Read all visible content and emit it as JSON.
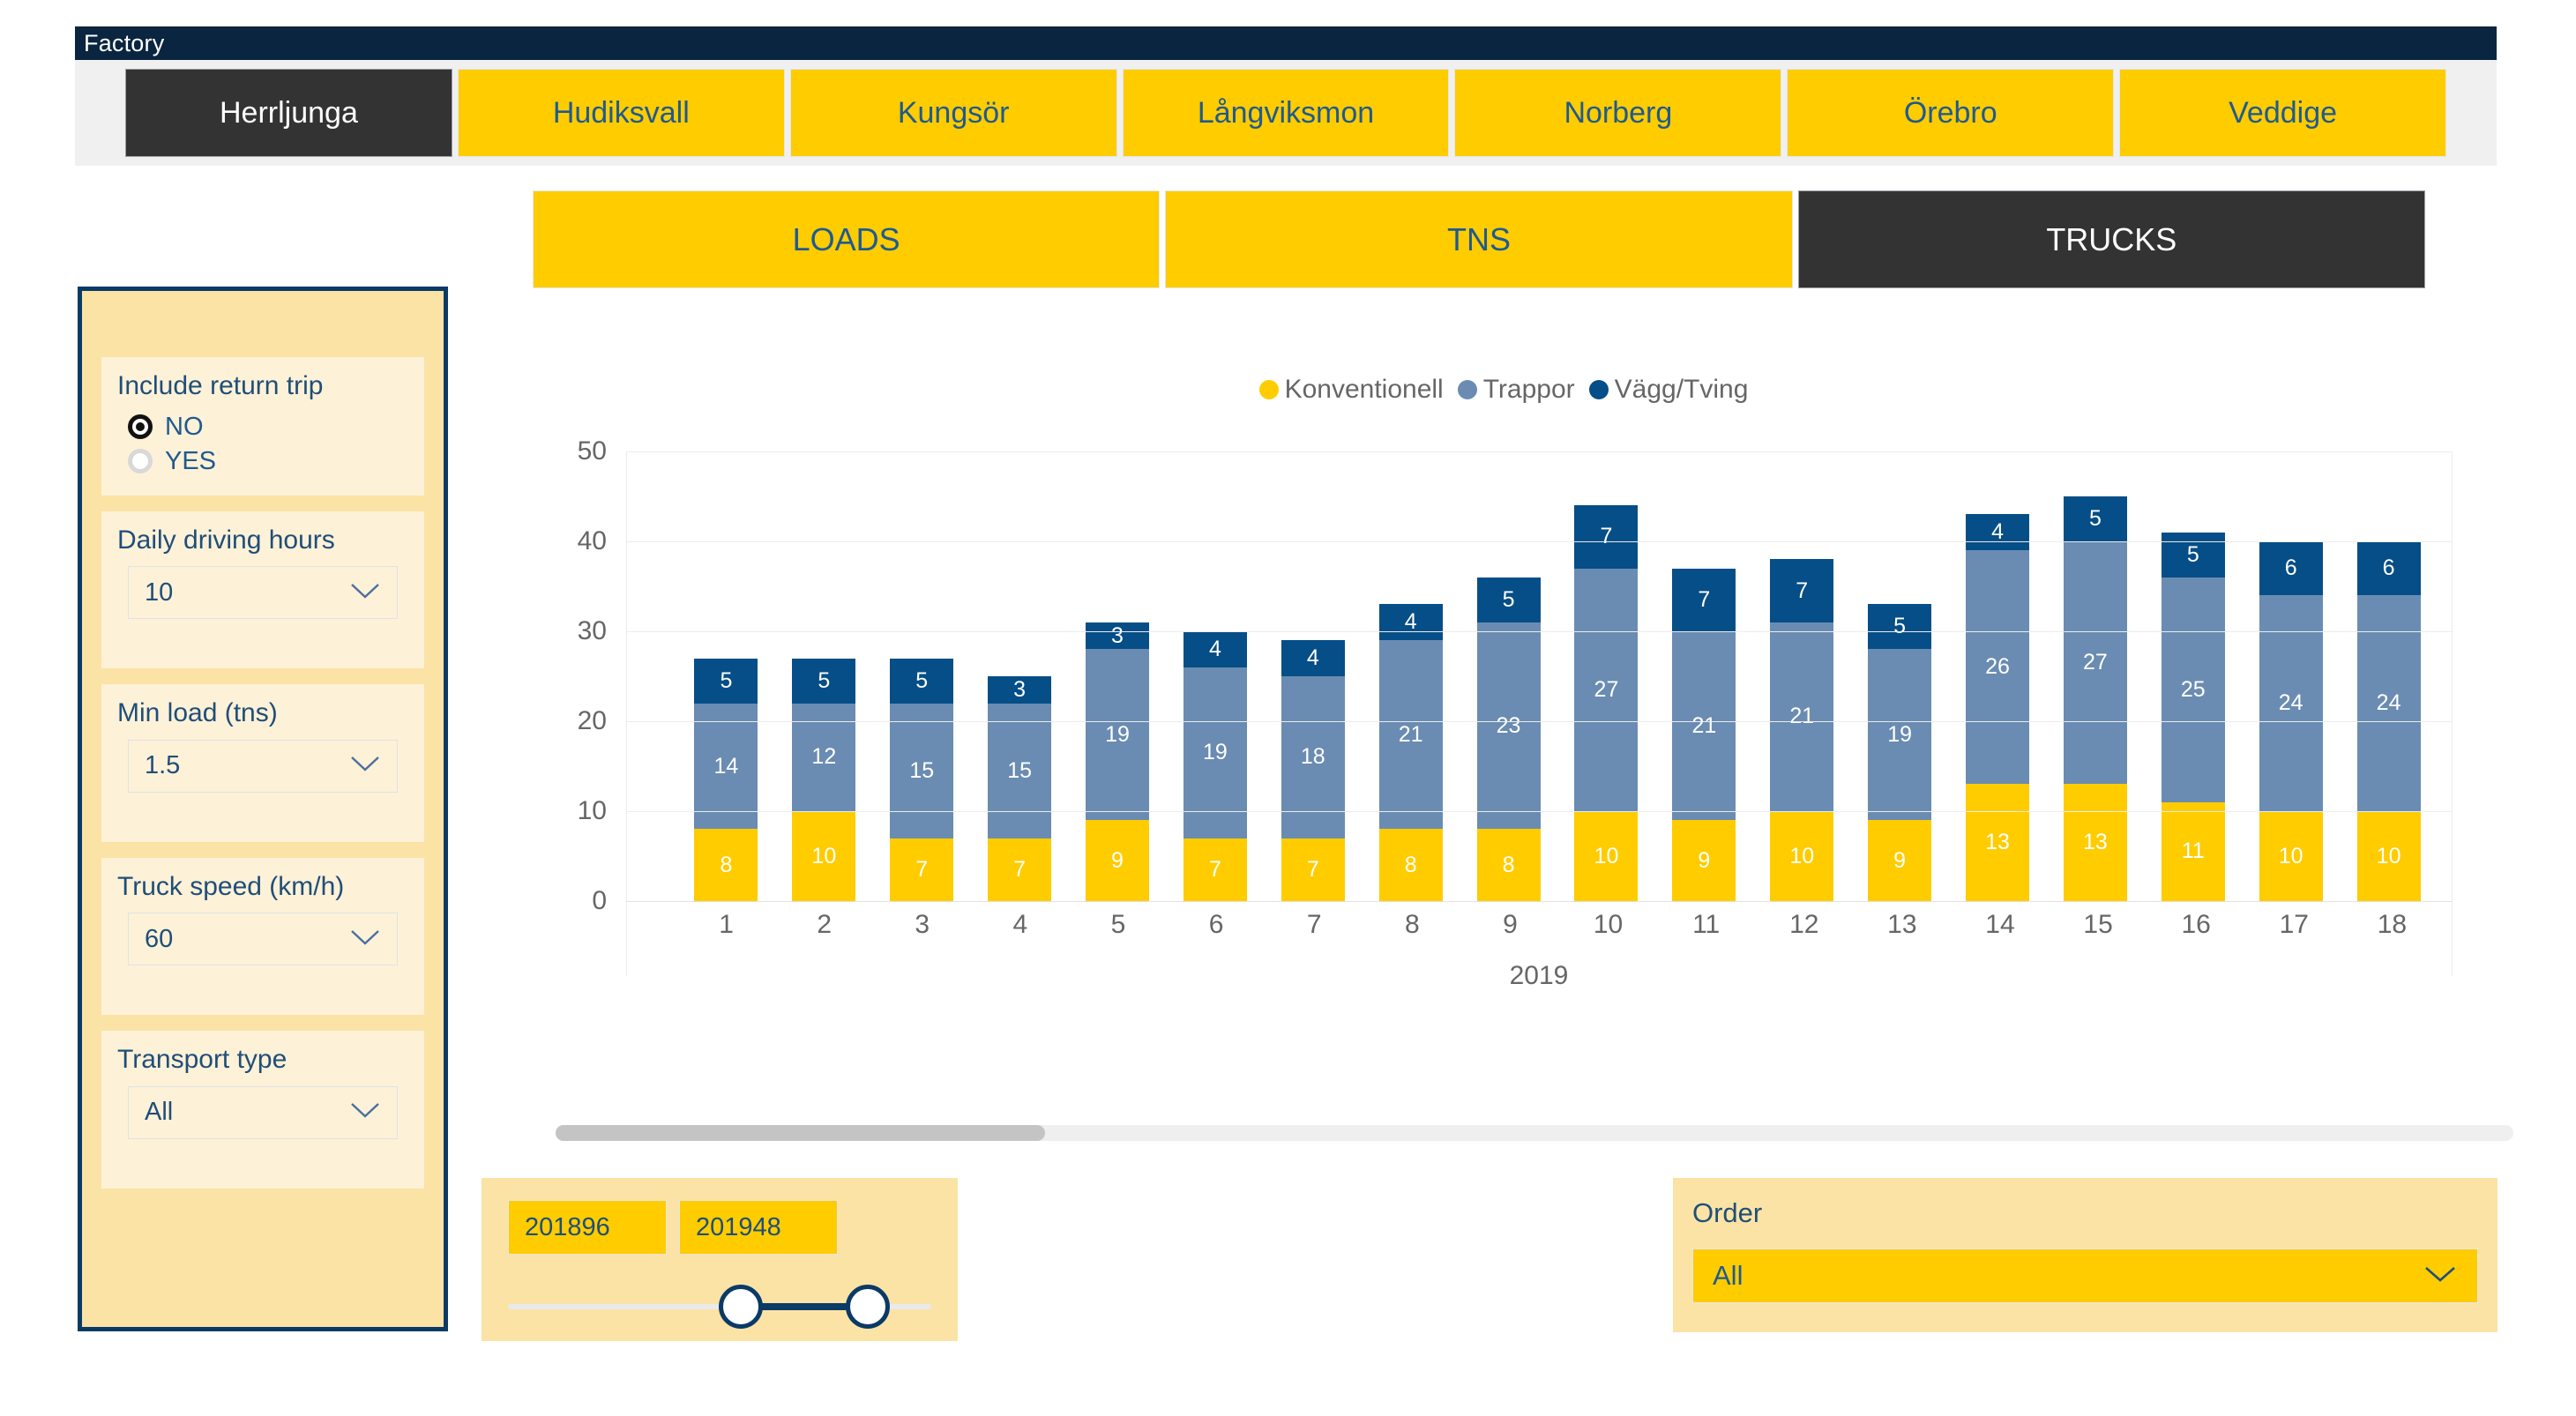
{
  "header": {
    "title": "Factory",
    "tabs": [
      {
        "label": "Herrljunga",
        "active": true
      },
      {
        "label": "Hudiksvall",
        "active": false
      },
      {
        "label": "Kungsör",
        "active": false
      },
      {
        "label": "Långviksmon",
        "active": false
      },
      {
        "label": "Norberg",
        "active": false
      },
      {
        "label": "Örebro",
        "active": false
      },
      {
        "label": "Veddige",
        "active": false
      }
    ]
  },
  "subtabs": [
    {
      "label": "LOADS",
      "active": false
    },
    {
      "label": "TNS",
      "active": false
    },
    {
      "label": "TRUCKS",
      "active": true
    }
  ],
  "sidebar": {
    "filters": [
      {
        "title": "Include return trip",
        "type": "radio",
        "options": [
          {
            "label": "NO",
            "checked": true
          },
          {
            "label": "YES",
            "checked": false
          }
        ]
      },
      {
        "title": "Daily driving hours",
        "type": "select",
        "value": "10"
      },
      {
        "title": "Min load (tns)",
        "type": "select",
        "value": "1.5"
      },
      {
        "title": "Truck speed (km/h)",
        "type": "select",
        "value": "60"
      },
      {
        "title": "Transport type",
        "type": "select",
        "value": "All"
      }
    ]
  },
  "range_filter": {
    "min_value": "201896",
    "max_value": "201948"
  },
  "order_filter": {
    "title": "Order",
    "value": "All"
  },
  "colors": {
    "accent_yellow": "#ffcc00",
    "dark_navy": "#0a2540",
    "active_tab": "#333333",
    "series_konventionell": "#ffcc00",
    "series_trappor": "#6a8cb2",
    "series_vagg_tving": "#064e87",
    "panel_bg": "#fbe3a6",
    "card_bg": "#fdf1d7"
  },
  "chart_data": {
    "type": "bar",
    "stacked": true,
    "title": "",
    "xlabel": "2019",
    "ylabel": "",
    "ylim": [
      0,
      50
    ],
    "yticks": [
      50,
      40,
      30,
      20,
      10,
      0
    ],
    "grid": true,
    "legend_position": "top-center",
    "categories": [
      "1",
      "2",
      "3",
      "4",
      "5",
      "6",
      "7",
      "8",
      "9",
      "10",
      "11",
      "12",
      "13",
      "14",
      "15",
      "16",
      "17",
      "18"
    ],
    "series": [
      {
        "name": "Konventionell",
        "color": "#ffcc00",
        "values": [
          8,
          10,
          7,
          7,
          9,
          7,
          7,
          8,
          8,
          10,
          9,
          10,
          9,
          13,
          13,
          11,
          10,
          10
        ]
      },
      {
        "name": "Trappor",
        "color": "#6a8cb2",
        "values": [
          14,
          12,
          15,
          15,
          19,
          19,
          18,
          21,
          23,
          27,
          21,
          21,
          19,
          26,
          27,
          25,
          24,
          24
        ]
      },
      {
        "name": "Vägg/Tving",
        "color": "#064e87",
        "values": [
          5,
          5,
          5,
          3,
          3,
          4,
          4,
          4,
          5,
          7,
          7,
          7,
          5,
          4,
          5,
          5,
          6,
          6
        ]
      }
    ],
    "totals": [
      27,
      27,
      27,
      25,
      31,
      30,
      29,
      33,
      36,
      44,
      37,
      38,
      33,
      43,
      45,
      41,
      40,
      40
    ]
  },
  "scrollbar": {
    "thumb_fraction": 0.25
  }
}
